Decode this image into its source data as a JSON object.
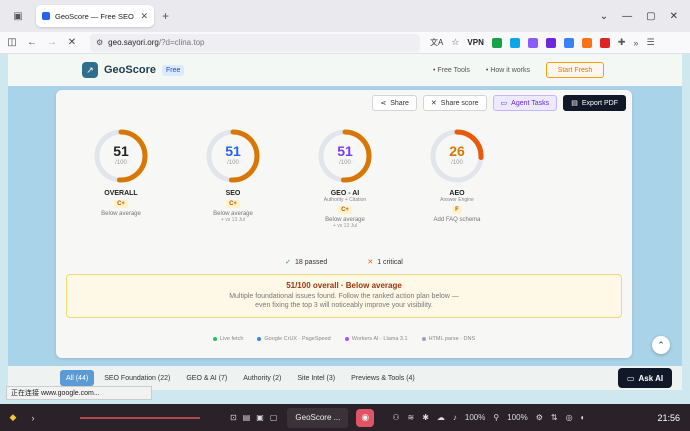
{
  "browser": {
    "tab_title": "GeoScore — Free SEO & AI Vi",
    "url_host": "geo.sayori.org",
    "url_path": "/?d=clina.top",
    "vpn_label": "VPN"
  },
  "site": {
    "logo_text": "GeoScore",
    "badge": "Free",
    "nav_free_tools": "• Free Tools",
    "nav_how": "• How it works",
    "start_fresh": "Start Fresh"
  },
  "actions": {
    "share": "Share",
    "share_score": "Share score",
    "agent_tasks": "Agent Tasks",
    "export_pdf": "Export PDF"
  },
  "gauges": [
    {
      "name": "OVERALL",
      "score": "51",
      "max": "/100",
      "fraction": 0.51,
      "color": "#d97706",
      "num_color": "#222222",
      "sub": "",
      "grade": "C+",
      "note": "Below average",
      "delta": ""
    },
    {
      "name": "SEO",
      "score": "51",
      "max": "/100",
      "fraction": 0.51,
      "color": "#d97706",
      "num_color": "#2563eb",
      "sub": "",
      "grade": "C+",
      "note": "Below average",
      "delta": "+ vs 13 Jul"
    },
    {
      "name": "GEO - AI",
      "score": "51",
      "max": "/100",
      "fraction": 0.51,
      "color": "#d97706",
      "num_color": "#7c3aed",
      "sub": "Authority + Citation",
      "grade": "C+",
      "note": "Below average",
      "delta": "+ vs 13 Jul"
    },
    {
      "name": "AEO",
      "score": "26",
      "max": "/100",
      "fraction": 0.26,
      "color": "#ea580c",
      "num_color": "#d97706",
      "sub": "Answer Engine",
      "grade": "F",
      "note": "Add FAQ schema",
      "delta": ""
    }
  ],
  "stats": {
    "passed": "18 passed",
    "critical": "1 critical"
  },
  "summary": {
    "title": "51/100 overall · Below average",
    "line1": "Multiple foundational issues found. Follow the ranked action plan below —",
    "line2": "even fixing the top 3 will noticeably improve your visibility."
  },
  "sources": [
    {
      "label": "Live fetch",
      "color": "#22c55e"
    },
    {
      "label": "Google CrUX · PageSpeed",
      "color": "#3b82f6"
    },
    {
      "label": "Workers AI · Llama 3.1",
      "color": "#a855f7"
    },
    {
      "label": "HTML parse · DNS",
      "color": "#9ca3af"
    }
  ],
  "filters": [
    "All (44)",
    "SEO Foundation (22)",
    "GEO & AI (7)",
    "Authority (2)",
    "Site Intel (3)",
    "Previews & Tools (4)"
  ],
  "ask_ai": "Ask AI",
  "status_text": "正在连接 www.google.com...",
  "taskbar": {
    "app_label": "GeoScore ...",
    "volume1": "100%",
    "volume2": "100%",
    "clock": "21:56"
  }
}
